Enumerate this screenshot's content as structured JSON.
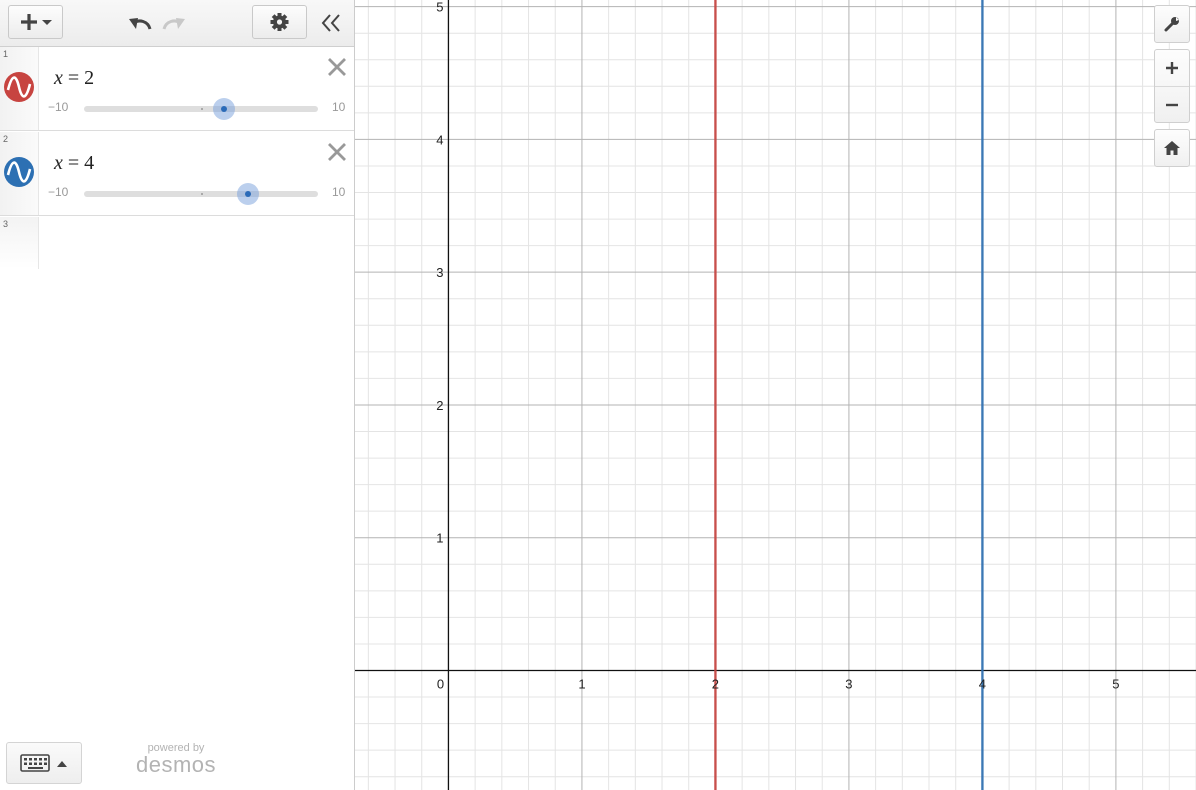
{
  "toolbar": {
    "add_icon": "plus-dropdown-icon",
    "undo_icon": "undo-icon",
    "redo_icon": "redo-icon",
    "settings_icon": "gear-icon",
    "collapse_icon": "double-chevron-left-icon"
  },
  "expressions": [
    {
      "index": "1",
      "variable": "x",
      "equals": " = ",
      "value": "2",
      "color": "#c74440",
      "slider": {
        "min": "−10",
        "max": "10",
        "value": 2
      }
    },
    {
      "index": "2",
      "variable": "x",
      "equals": " = ",
      "value": "4",
      "color": "#2d70b3",
      "slider": {
        "min": "−10",
        "max": "10",
        "value": 4
      }
    },
    {
      "index": "3"
    }
  ],
  "graph": {
    "x_ticks": [
      "0",
      "1",
      "2",
      "3",
      "4",
      "5"
    ],
    "y_ticks": [
      "1",
      "2",
      "3",
      "4",
      "5"
    ],
    "lines": [
      {
        "x": 2,
        "color": "#c74440"
      },
      {
        "x": 4,
        "color": "#2d70b3"
      }
    ],
    "xlim": [
      -0.7,
      5.6
    ],
    "ylim": [
      -0.9,
      5.05
    ]
  },
  "graph_controls": {
    "wrench_icon": "wrench-icon",
    "zoom_in_icon": "plus-icon",
    "zoom_out_icon": "minus-icon",
    "home_icon": "home-icon"
  },
  "branding": {
    "powered_by": "powered by",
    "name": "desmos"
  }
}
